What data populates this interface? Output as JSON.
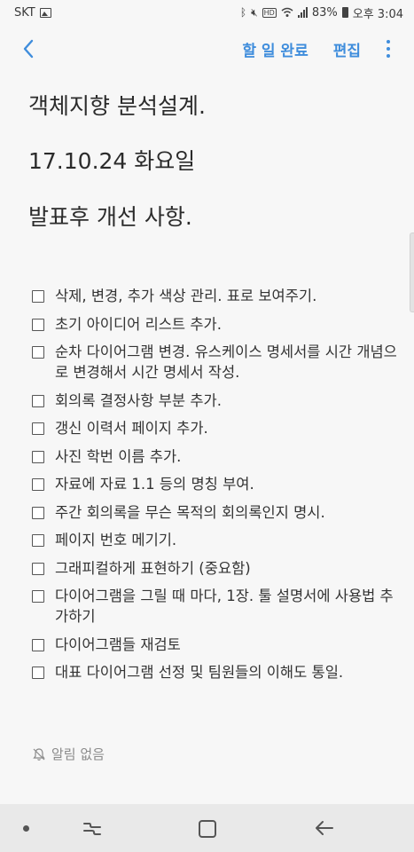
{
  "status_bar": {
    "carrier": "SKT",
    "icons": [
      "image-icon",
      "bluetooth-icon",
      "mute-icon",
      "hd-voice-icon",
      "wifi-icon",
      "signal-icon",
      "battery-icon"
    ],
    "hd_label": "HD",
    "battery": "83%",
    "time": "오후 3:04"
  },
  "toolbar": {
    "complete_label": "할 일 완료",
    "edit_label": "편집"
  },
  "note": {
    "lines": [
      "객체지향 분석설계.",
      "17.10.24 화요일",
      "발표후 개선 사항."
    ]
  },
  "checklist": [
    "삭제, 변경, 추가 색상 관리. 표로 보여주기.",
    "초기 아이디어 리스트 추가.",
    "순차 다이어그램 변경. 유스케이스 명세서를 시간 개념으로 변경해서 시간 명세서 작성.",
    "회의록 결정사항 부분 추가.",
    "갱신 이력서 페이지 추가.",
    "사진 학번 이름 추가.",
    "자료에 자료 1.1 등의 명칭 부여.",
    "주간 회의록을 무슨 목적의 회의록인지 명시.",
    "페이지 번호 메기기.",
    "그래피컬하게 표현하기 (중요함)",
    "다이어그램을 그릴 때 마다, 1장. 툴 설명서에 사용법 추가하기",
    "다이어그램들 재검토",
    "대표 다이어그램 선정 및 팀원들의 이해도 통일."
  ],
  "reminder": {
    "label": "알림 없음"
  },
  "colors": {
    "accent": "#3f8ddc",
    "background": "#f7f7f7",
    "nav_bar": "#e9e9e9"
  }
}
